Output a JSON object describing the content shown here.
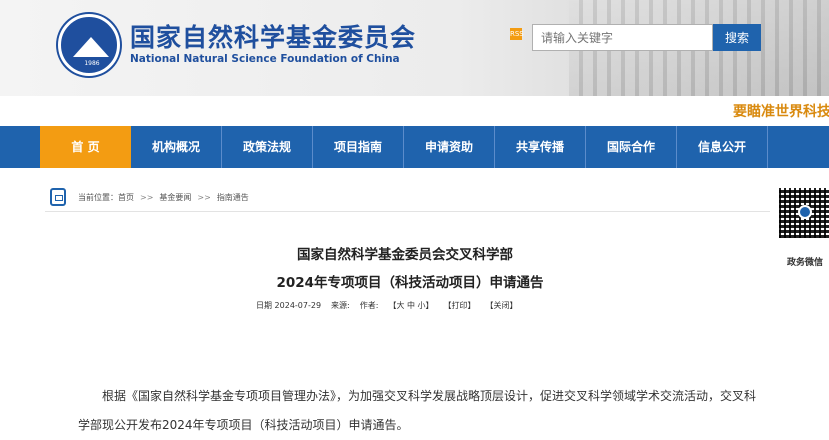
{
  "header": {
    "emblem_year": "1986",
    "title_cn": "国家自然科学基金委员会",
    "title_en": "National Natural Science Foundation of China",
    "rss_label": "RSS",
    "search_placeholder": "请输入关键字",
    "search_button": "搜索"
  },
  "slogan": "要瞄准世界科技",
  "nav": {
    "items": [
      "首  页",
      "机构概况",
      "政策法规",
      "项目指南",
      "申请资助",
      "共享传播",
      "国际合作",
      "信息公开"
    ]
  },
  "breadcrumb": {
    "prefix": "当前位置：",
    "home": "首页",
    "sep": ">>",
    "level1": "基金要闻",
    "level2": "指南通告"
  },
  "qr": {
    "caption": "政务微信"
  },
  "article": {
    "title_line1": "国家自然科学基金委员会交叉科学部",
    "title_line2": "2024年专项项目（科技活动项目）申请通告",
    "date_label": "日期",
    "date": "2024-07-29",
    "source_label": "来源:",
    "author_label": "作者:",
    "font_size_links": "【大 中 小】",
    "print_link": "【打印】",
    "close_link": "【关闭】",
    "paragraph": "根据《国家自然科学基金专项项目管理办法》，为加强交叉科学发展战略顶层设计，促进交叉科学领域学术交流活动，交叉科学部现公开发布2024年专项项目（科技活动项目）申请通告。"
  },
  "colors": {
    "brand_blue": "#1f63ad",
    "accent_orange": "#f39c12",
    "slogan_gold": "#d98a0f"
  }
}
